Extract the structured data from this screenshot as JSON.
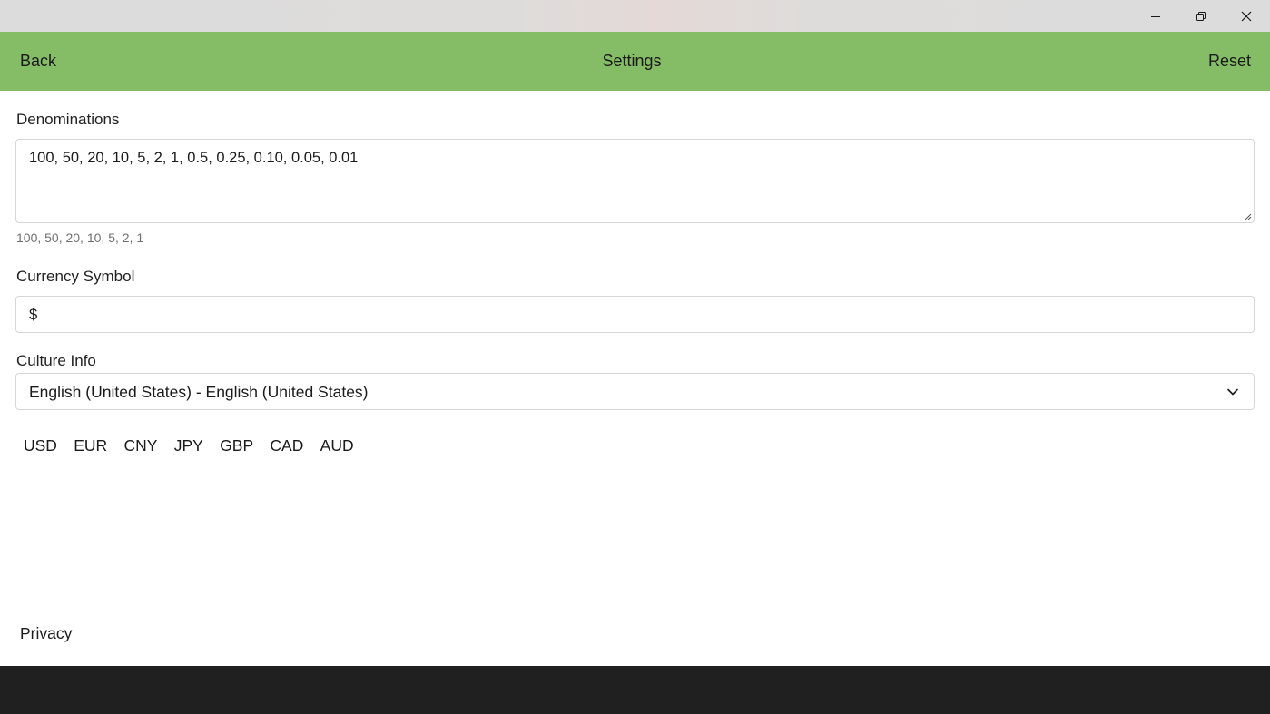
{
  "window": {
    "controls": [
      "minimize-icon",
      "restore-icon",
      "close-icon"
    ]
  },
  "appbar": {
    "back_label": "Back",
    "title": "Settings",
    "reset_label": "Reset",
    "background": "#85bd66"
  },
  "denominations": {
    "label": "Denominations",
    "value": "100, 50, 20, 10, 5, 2, 1, 0.5, 0.25, 0.10, 0.05, 0.01",
    "hint": "100, 50, 20, 10, 5, 2, 1"
  },
  "currency_symbol": {
    "label": "Currency Symbol",
    "value": "$"
  },
  "culture_info": {
    "label": "Culture Info",
    "selected": "English (United States) - English (United States)",
    "icon": "chevron-down-icon"
  },
  "currencies": [
    "USD",
    "EUR",
    "CNY",
    "JPY",
    "GBP",
    "CAD",
    "AUD"
  ],
  "footer": {
    "privacy_label": "Privacy"
  }
}
